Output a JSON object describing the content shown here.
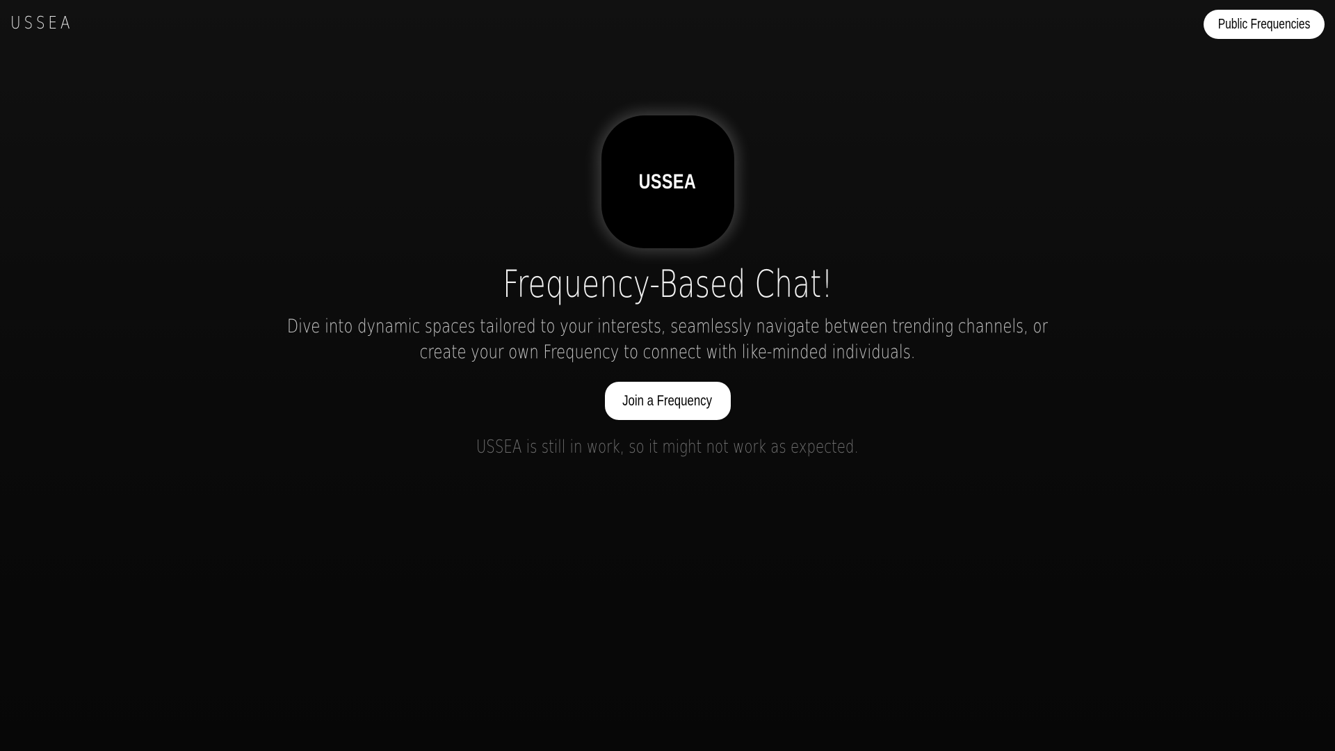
{
  "header": {
    "brand": "USSEA",
    "nav_button_label": "Public Frequencies"
  },
  "hero": {
    "logo_text": "USSEA",
    "headline": "Frequency-Based Chat!",
    "description": "Dive into dynamic spaces tailored to your interests, seamlessly navigate between trending channels, or create your own Frequency to connect with like-minded individuals.",
    "cta_label": "Join a Frequency",
    "notice": "USSEA is still in work, so it might not work as expected."
  },
  "colors": {
    "background": "#0b0b0b",
    "button_background": "#ffffff",
    "button_text": "#000000",
    "notice_text": "#6f6f6f"
  }
}
